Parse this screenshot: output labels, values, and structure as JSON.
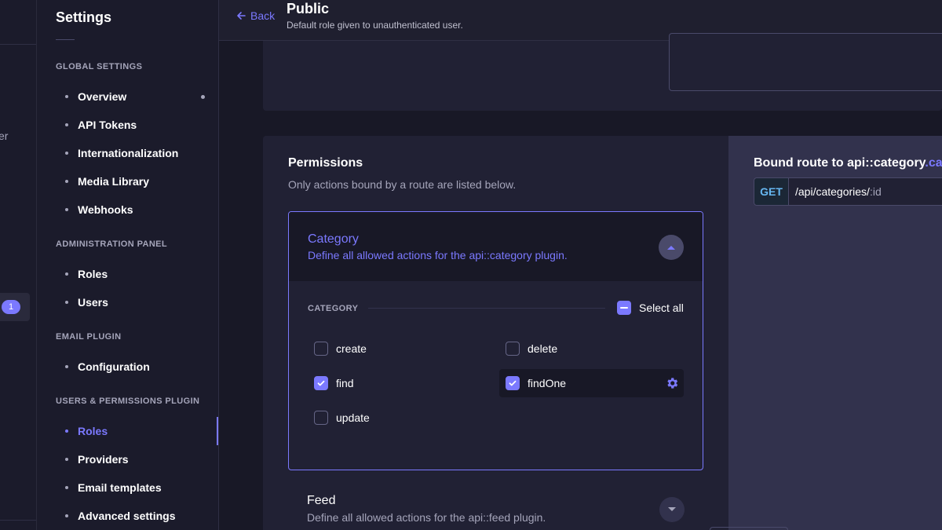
{
  "strip": {
    "cut_text": "er",
    "badge_count": "1"
  },
  "sidebar": {
    "title": "Settings",
    "sections": [
      {
        "label": "GLOBAL SETTINGS",
        "items": [
          "Overview",
          "API Tokens",
          "Internationalization",
          "Media Library",
          "Webhooks"
        ]
      },
      {
        "label": "ADMINISTRATION PANEL",
        "items": [
          "Roles",
          "Users"
        ]
      },
      {
        "label": "EMAIL PLUGIN",
        "items": [
          "Configuration"
        ]
      },
      {
        "label": "USERS & PERMISSIONS PLUGIN",
        "items": [
          "Roles",
          "Providers",
          "Email templates",
          "Advanced settings"
        ]
      }
    ],
    "active_item": "Roles"
  },
  "header": {
    "back_label": "Back",
    "title": "Public",
    "subtitle": "Default role given to unauthenticated user."
  },
  "permissions": {
    "title": "Permissions",
    "subtitle": "Only actions bound by a route are listed below.",
    "open_group": {
      "name": "Category",
      "description": "Define all allowed actions for the api::category plugin.",
      "section_label": "CATEGORY",
      "select_all_label": "Select all",
      "select_all_state": "indeterminate",
      "actions": [
        {
          "label": "create",
          "checked": false
        },
        {
          "label": "delete",
          "checked": false
        },
        {
          "label": "find",
          "checked": true
        },
        {
          "label": "findOne",
          "checked": true,
          "selected": true
        },
        {
          "label": "update",
          "checked": false
        }
      ]
    },
    "closed_group": {
      "name": "Feed",
      "description": "Define all allowed actions for the api::feed plugin."
    }
  },
  "route": {
    "title_prefix": "Bound route to ",
    "title_main": "api::category",
    "title_accent": ".cat",
    "method": "GET",
    "path_main": "/api/categories/",
    "path_param": ":id"
  },
  "colors": {
    "accent": "#7b79ff",
    "bg": "#181826",
    "panel": "#212134",
    "route_panel": "#32324d",
    "get_method": "#66b7f1"
  }
}
